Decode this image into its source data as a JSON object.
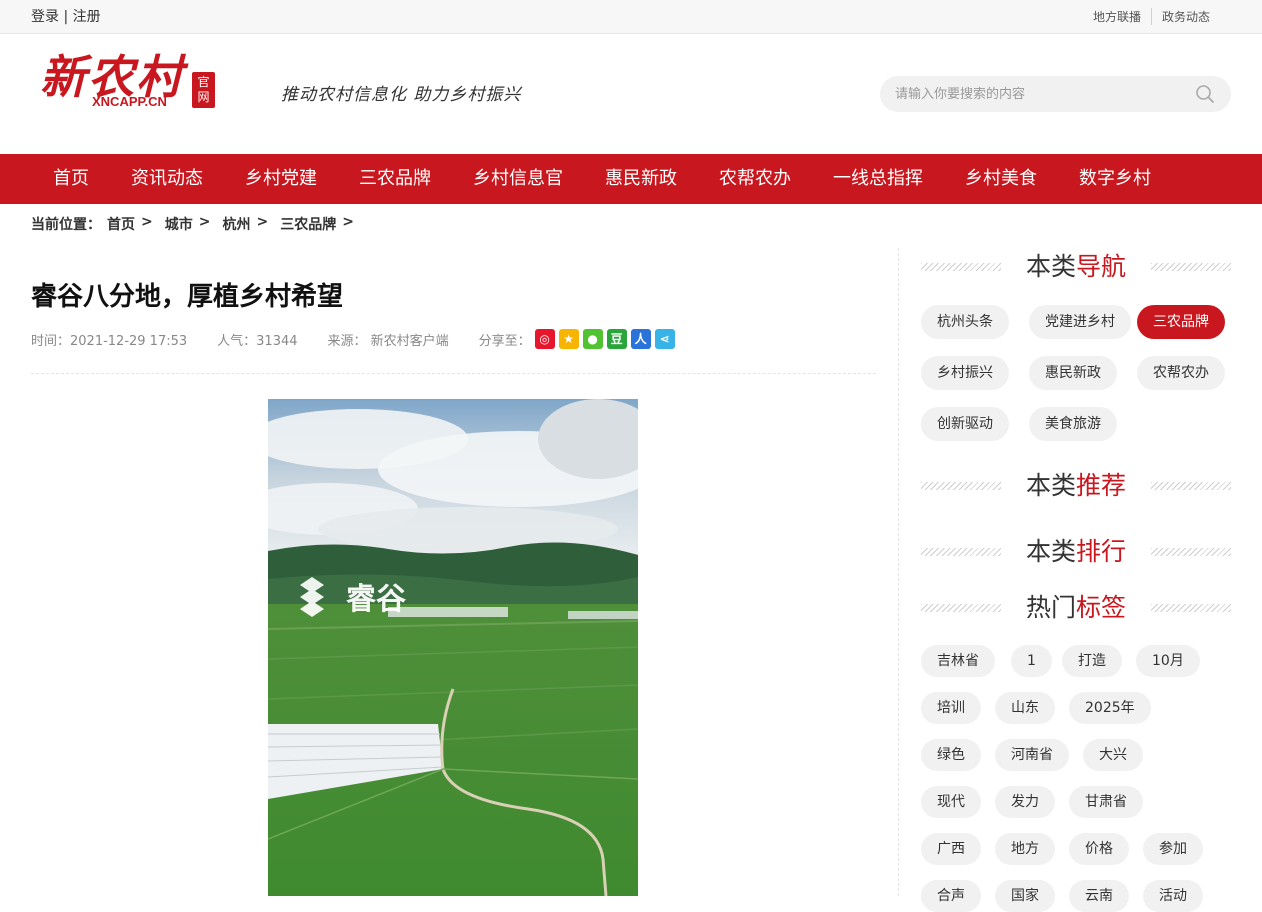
{
  "topbar": {
    "login": "登录",
    "divider": "|",
    "register": "注册",
    "links": [
      "地方联播",
      "政务动态"
    ]
  },
  "header": {
    "logo_text": "新农村",
    "logo_sub": "XNCAPP.CN",
    "logo_badge_1": "官",
    "logo_badge_2": "网",
    "slogan": "推动农村信息化 助力乡村振兴",
    "search_placeholder": "请输入你要搜索的内容"
  },
  "nav": [
    "首页",
    "资讯动态",
    "乡村党建",
    "三农品牌",
    "乡村信息官",
    "惠民新政",
    "农帮农办",
    "一线总指挥",
    "乡村美食",
    "数字乡村"
  ],
  "breadcrumb": {
    "label": "当前位置：",
    "items": [
      "首页",
      "城市",
      "杭州",
      "三农品牌"
    ],
    "sep": ">"
  },
  "article": {
    "title": "睿谷八分地，厚植乡村希望",
    "time": "时间：2021-12-29 17:53",
    "views": "人气：31344",
    "source": "来源： 新农村客户端",
    "share_label": "分享至：",
    "share_icons": [
      "weibo-icon",
      "qzone-icon",
      "wechat-icon",
      "douban-icon",
      "renren-icon",
      "share-icon"
    ],
    "image_brand": "睿谷"
  },
  "sidebar": {
    "nav_title_a": "本类",
    "nav_title_b": "导航",
    "nav_tags": [
      "杭州头条",
      "党建进乡村",
      "三农品牌",
      "乡村振兴",
      "惠民新政",
      "农帮农办",
      "创新驱动",
      "美食旅游"
    ],
    "active_tag": "三农品牌",
    "rec_title_a": "本类",
    "rec_title_b": "推荐",
    "rank_title_a": "本类",
    "rank_title_b": "排行",
    "hot_title_a": "热门",
    "hot_title_b": "标签",
    "hot_tags": [
      "吉林省",
      "1",
      "打造",
      "10月",
      "培训",
      "山东",
      "2025年",
      "绿色",
      "河南省",
      "大兴",
      "现代",
      "发力",
      "甘肃省",
      "广西",
      "地方",
      "价格",
      "参加",
      "合声",
      "国家",
      "云南",
      "活动"
    ]
  },
  "colors": {
    "brand_red": "#c8171e"
  }
}
